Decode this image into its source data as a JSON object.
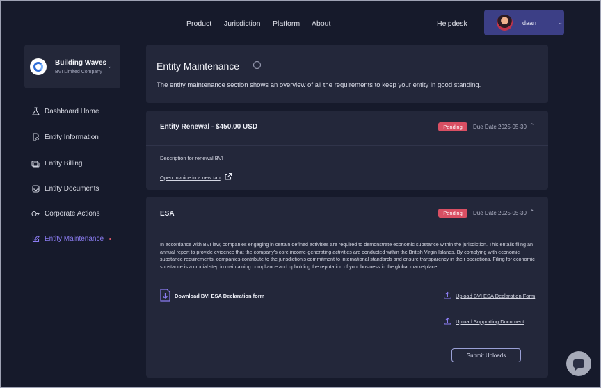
{
  "nav": {
    "links": [
      "Product",
      "Jurisdiction",
      "Platform",
      "About"
    ],
    "helpdesk": "Helpdesk",
    "user": {
      "name": "daan"
    }
  },
  "org": {
    "name": "Building Waves",
    "type": "BVI Limited Company"
  },
  "sidebar": {
    "items": [
      {
        "label": "Dashboard Home",
        "icon": "flask-icon"
      },
      {
        "label": "Entity Information",
        "icon": "document-search-icon"
      },
      {
        "label": "Entity Billing",
        "icon": "billing-icon"
      },
      {
        "label": "Entity Documents",
        "icon": "inbox-icon"
      },
      {
        "label": "Corporate Actions",
        "icon": "actions-icon"
      },
      {
        "label": "Entity Maintenance",
        "icon": "edit-icon",
        "active": true
      }
    ]
  },
  "header": {
    "title": "Entity Maintenance",
    "description": "The entity maintenance section shows an overview of all the requirements to keep your entity in good standing."
  },
  "renewal": {
    "title": "Entity Renewal - $450.00 USD",
    "status": "Pending",
    "due": "Due Date 2025-05-30",
    "description": "Description for renewal BVI",
    "invoice_link": "Open Invoice in a new tab"
  },
  "esa": {
    "title": "ESA",
    "status": "Pending",
    "due": "Due Date 2025-05-30",
    "description": "In accordance with BVI law, companies engaging in certain defined activities are required to demonstrate economic substance within the jurisdiction. This entails filing an annual report to provide evidence that the company's core income-generating activities are conducted within the British Virgin Islands. By complying with economic substance requirements, companies contribute to the jurisdiction's commitment to international standards and ensure transparency in their operations. Filing for economic substance is a crucial step in maintaining compliance and upholding the reputation of your business in the global marketplace.",
    "download_label": "Download BVI ESA Declaration form",
    "upload_declaration": "Upload BVI ESA Declaration Form",
    "upload_supporting": "Upload Supporting Document",
    "submit_label": "Submit Uploads"
  },
  "colors": {
    "accent": "#8b7cf2",
    "badge": "#d94f63",
    "user_chip": "#3c3f86"
  }
}
